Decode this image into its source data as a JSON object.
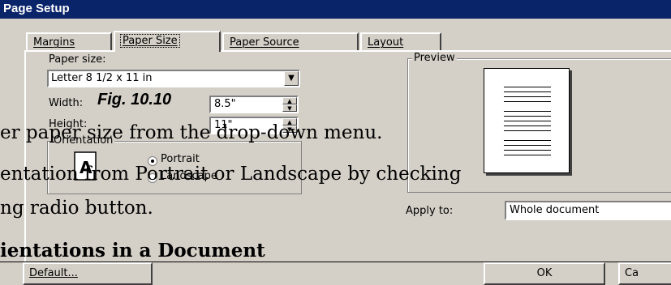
{
  "window": {
    "title": "Page Setup"
  },
  "tabs": [
    {
      "label": "Margins",
      "active": false
    },
    {
      "label": "Paper Size",
      "active": true
    },
    {
      "label": "Paper Source",
      "active": false
    },
    {
      "label": "Layout",
      "active": false
    }
  ],
  "paper_size": {
    "label": "Paper size:",
    "value": "Letter 8 1/2 x 11 in",
    "width_label": "Width:",
    "width_value": "8.5\"",
    "height_label": "Height:",
    "height_value": "11\""
  },
  "orientation": {
    "label": "Orientation",
    "portrait_label": "Portrait",
    "landscape_label": "Landscape",
    "selected": "portrait"
  },
  "preview": {
    "label": "Preview"
  },
  "apply_to": {
    "label": "Apply to:",
    "value": "Whole document"
  },
  "buttons": {
    "default": "Default...",
    "ok": "OK",
    "cancel": "Ca"
  },
  "figure_caption": "Fig. 10.10",
  "overlay": {
    "line1": "er paper size from the drop-down menu.",
    "line2": "entation from Portrait or Landscape by checking",
    "line3": "ng radio button.",
    "heading": "ientations in a Document"
  },
  "colors": {
    "titlebar": "#0a246a",
    "dialog_face": "#d4d0c8"
  }
}
